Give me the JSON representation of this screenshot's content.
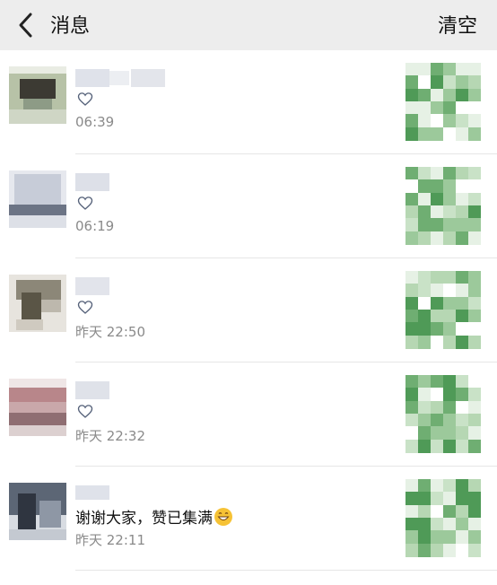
{
  "header": {
    "title": "消息",
    "clear_label": "清空"
  },
  "messages": [
    {
      "time": "06:39",
      "type": "like"
    },
    {
      "time": "06:19",
      "type": "like"
    },
    {
      "time": "昨天 22:50",
      "type": "like"
    },
    {
      "time": "昨天 22:32",
      "type": "like"
    },
    {
      "time": "昨天 22:11",
      "type": "comment",
      "comment": "谢谢大家，赞已集满"
    }
  ],
  "colors": {
    "header_bg": "#ededed",
    "time_text": "#8a8a8a",
    "thumb_green": "#7fba7f"
  },
  "icons": {
    "back": "chevron-left-icon",
    "like": "heart-outline-icon",
    "emoji": "grinning-face-icon"
  }
}
